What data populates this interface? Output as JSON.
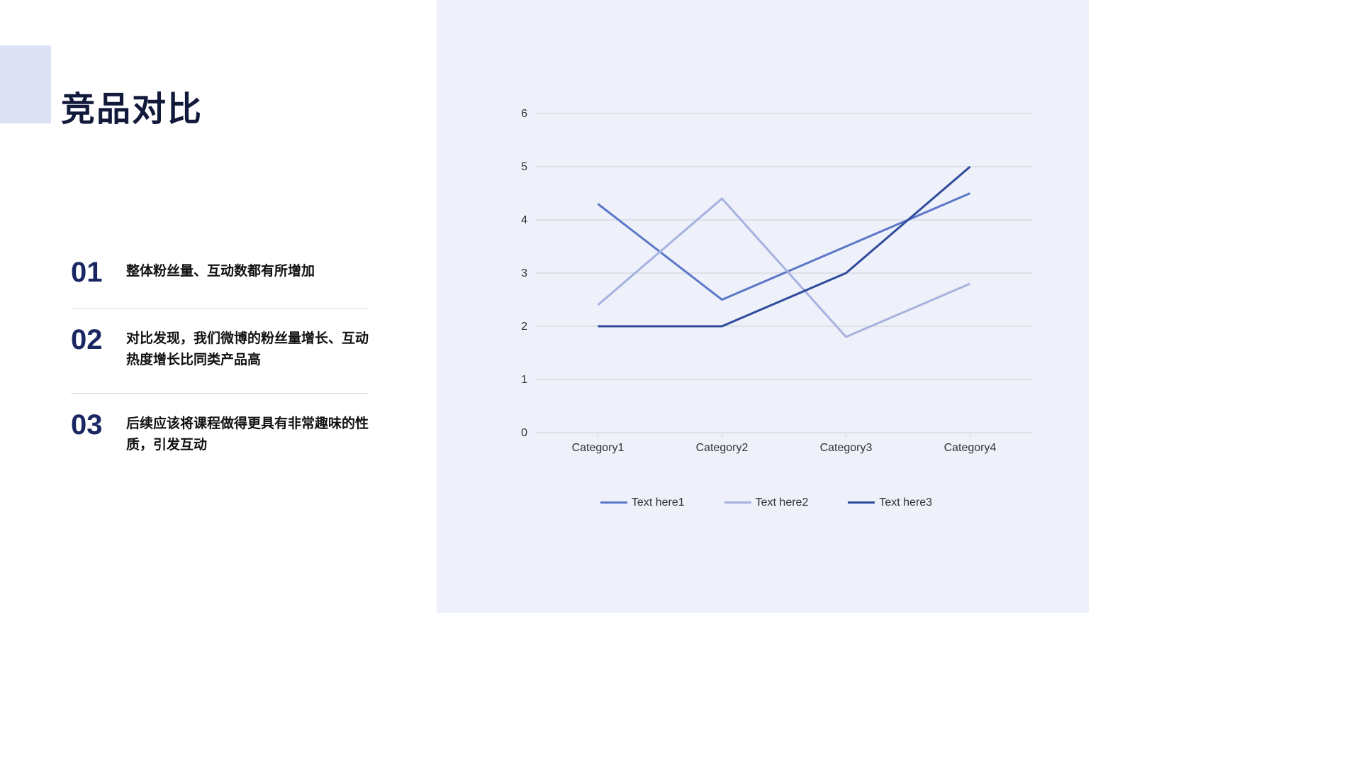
{
  "title": "竞品对比",
  "points": [
    {
      "num": "01",
      "text": "整体粉丝量、互动数都有所增加"
    },
    {
      "num": "02",
      "text": "对比发现，我们微博的粉丝量增长、互动热度增长比同类产品高"
    },
    {
      "num": "03",
      "text": "后续应该将课程做得更具有非常趣味的性质，引发互动"
    }
  ],
  "chart_data": {
    "type": "line",
    "categories": [
      "Category1",
      "Category2",
      "Category3",
      "Category4"
    ],
    "series": [
      {
        "name": "Text here1",
        "values": [
          4.3,
          2.5,
          3.5,
          4.5
        ],
        "color": "#5b77c8"
      },
      {
        "name": "Text here2",
        "values": [
          2.4,
          4.4,
          1.8,
          2.8
        ],
        "color": "#a6b2e0"
      },
      {
        "name": "Text here3",
        "values": [
          2.0,
          2.0,
          3.0,
          5.0
        ],
        "color": "#2e4a9a"
      }
    ],
    "ylim": [
      0,
      6
    ],
    "yticks": [
      0,
      1,
      2,
      3,
      4,
      5,
      6
    ],
    "xlabel": "",
    "ylabel": "",
    "title": ""
  }
}
